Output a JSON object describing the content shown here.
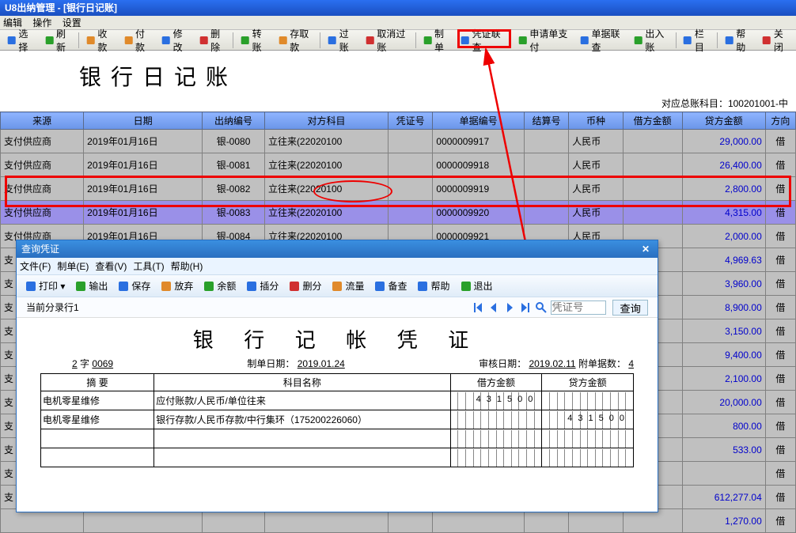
{
  "window": {
    "title": "U8出纳管理 - [银行日记账]"
  },
  "menu": [
    "编辑",
    "操作",
    "设置"
  ],
  "toolbar": [
    {
      "id": "select",
      "label": "选择"
    },
    {
      "id": "refresh",
      "label": "刷新"
    },
    {
      "id": "receipt",
      "label": "收款"
    },
    {
      "id": "pay",
      "label": "付款"
    },
    {
      "id": "edit",
      "label": "修改"
    },
    {
      "id": "delete",
      "label": "删除"
    },
    {
      "id": "transfer",
      "label": "转账"
    },
    {
      "id": "withdraw",
      "label": "存取款"
    },
    {
      "id": "post",
      "label": "过账"
    },
    {
      "id": "unpost",
      "label": "取消过账"
    },
    {
      "id": "make",
      "label": "制单"
    },
    {
      "id": "voucher-link",
      "label": "凭证联查"
    },
    {
      "id": "apply-pay",
      "label": "申请单支付"
    },
    {
      "id": "doc-link",
      "label": "单据联查"
    },
    {
      "id": "import",
      "label": "出入账"
    },
    {
      "id": "columns",
      "label": "栏目"
    },
    {
      "id": "help",
      "label": "帮助"
    },
    {
      "id": "close",
      "label": "关闭"
    }
  ],
  "page_title": "银行日记账",
  "sub_info": "对应总账科目：100201001-中",
  "columns": [
    "来源",
    "日期",
    "出纳编号",
    "对方科目",
    "凭证号",
    "单据编号",
    "结算号",
    "币种",
    "借方金额",
    "贷方金额",
    "方向"
  ],
  "rows": [
    {
      "src": "支付供应商",
      "date": "2019年01月16日",
      "no": "银-0080",
      "subj": "立往来(22020100",
      "vch": "",
      "doc": "0000009917",
      "settle": "",
      "cur": "人民币",
      "debit": "",
      "credit": "29,000.00",
      "dir": "借"
    },
    {
      "src": "支付供应商",
      "date": "2019年01月16日",
      "no": "银-0081",
      "subj": "立往来(22020100",
      "vch": "",
      "doc": "0000009918",
      "settle": "",
      "cur": "人民币",
      "debit": "",
      "credit": "26,400.00",
      "dir": "借"
    },
    {
      "src": "支付供应商",
      "date": "2019年01月16日",
      "no": "银-0082",
      "subj": "立往来(22020100",
      "vch": "",
      "doc": "0000009919",
      "settle": "",
      "cur": "人民币",
      "debit": "",
      "credit": "2,800.00",
      "dir": "借"
    },
    {
      "src": "支付供应商",
      "date": "2019年01月16日",
      "no": "银-0083",
      "subj": "立往来(22020100",
      "vch": "",
      "doc": "0000009920",
      "settle": "",
      "cur": "人民币",
      "debit": "",
      "credit": "4,315.00",
      "dir": "借",
      "hl": true
    },
    {
      "src": "支付供应商",
      "date": "2019年01月16日",
      "no": "银-0084",
      "subj": "立往来(22020100",
      "vch": "",
      "doc": "0000009921",
      "settle": "",
      "cur": "人民币",
      "debit": "",
      "credit": "2,000.00",
      "dir": "借"
    },
    {
      "src": "支",
      "date": "",
      "no": "",
      "subj": "",
      "vch": "",
      "doc": "",
      "settle": "",
      "cur": "",
      "debit": "",
      "credit": "4,969.63",
      "dir": "借"
    },
    {
      "src": "支",
      "date": "",
      "no": "",
      "subj": "",
      "vch": "",
      "doc": "",
      "settle": "",
      "cur": "",
      "debit": "",
      "credit": "3,960.00",
      "dir": "借"
    },
    {
      "src": "支",
      "date": "",
      "no": "",
      "subj": "",
      "vch": "",
      "doc": "",
      "settle": "",
      "cur": "",
      "debit": "",
      "credit": "8,900.00",
      "dir": "借"
    },
    {
      "src": "支",
      "date": "",
      "no": "",
      "subj": "",
      "vch": "",
      "doc": "",
      "settle": "",
      "cur": "",
      "debit": "",
      "credit": "3,150.00",
      "dir": "借"
    },
    {
      "src": "支",
      "date": "",
      "no": "",
      "subj": "",
      "vch": "",
      "doc": "",
      "settle": "",
      "cur": "",
      "debit": "",
      "credit": "9,400.00",
      "dir": "借"
    },
    {
      "src": "支",
      "date": "",
      "no": "",
      "subj": "",
      "vch": "",
      "doc": "",
      "settle": "",
      "cur": "",
      "debit": "",
      "credit": "2,100.00",
      "dir": "借"
    },
    {
      "src": "支",
      "date": "",
      "no": "",
      "subj": "",
      "vch": "",
      "doc": "",
      "settle": "",
      "cur": "",
      "debit": "",
      "credit": "20,000.00",
      "dir": "借"
    },
    {
      "src": "支",
      "date": "",
      "no": "",
      "subj": "",
      "vch": "",
      "doc": "",
      "settle": "",
      "cur": "",
      "debit": "",
      "credit": "800.00",
      "dir": "借"
    },
    {
      "src": "支",
      "date": "",
      "no": "",
      "subj": "",
      "vch": "",
      "doc": "",
      "settle": "",
      "cur": "",
      "debit": "",
      "credit": "533.00",
      "dir": "借"
    },
    {
      "src": "支",
      "date": "",
      "no": "",
      "subj": "",
      "vch": "",
      "doc": "",
      "settle": "",
      "cur": "",
      "debit": "",
      "credit": "",
      "dir": "借"
    },
    {
      "src": "支",
      "date": "",
      "no": "",
      "subj": "",
      "vch": "",
      "doc": "",
      "settle": "",
      "cur": "",
      "debit": "",
      "credit": "612,277.04",
      "dir": "借"
    },
    {
      "src": "",
      "date": "",
      "no": "",
      "subj": "",
      "vch": "",
      "doc": "",
      "settle": "",
      "cur": "",
      "debit": "",
      "credit": "1,270.00",
      "dir": "借"
    }
  ],
  "dialog": {
    "title": "查询凭证",
    "menu": [
      "文件(F)",
      "制单(E)",
      "查看(V)",
      "工具(T)",
      "帮助(H)"
    ],
    "toolbar": [
      "打印 ▾",
      "输出",
      "保存",
      "放弃",
      "余额",
      "插分",
      "删分",
      "流量",
      "备查",
      "帮助",
      "退出"
    ],
    "entry_label": "当前分录行1",
    "voucher_no_ph": "凭证号",
    "query_btn": "查询",
    "voucher_title": "银 行 记 帐 凭 证",
    "meta": {
      "serial_prefix": "2",
      "serial_char": "字",
      "serial_no": "0069",
      "make_label": "制单日期：",
      "make_date": "2019.01.24",
      "audit_label": "审核日期：",
      "audit_date": "2019.02.11",
      "attach_label": "附单据数：",
      "attach": "4"
    },
    "vcols": [
      "摘 要",
      "科目名称",
      "借方金额",
      "贷方金额"
    ],
    "vrows": [
      {
        "summary": "电机零星维修",
        "subject": "应付账款/人民币/单位往来",
        "debit": "431500",
        "credit": ""
      },
      {
        "summary": "电机零星维修",
        "subject": "银行存款/人民币存款/中行集环（175200226060）",
        "debit": "",
        "credit": "431500"
      },
      {
        "summary": "",
        "subject": "",
        "debit": "",
        "credit": ""
      },
      {
        "summary": "",
        "subject": "",
        "debit": "",
        "credit": ""
      }
    ]
  }
}
